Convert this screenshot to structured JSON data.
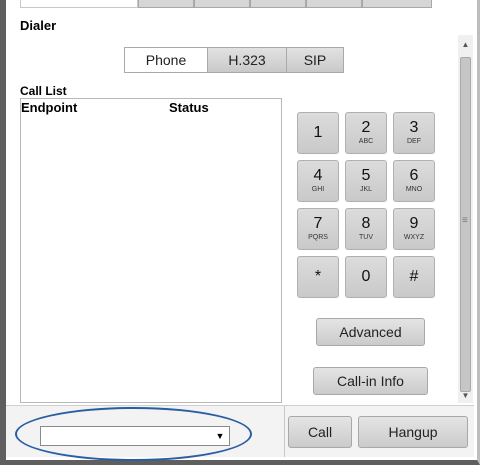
{
  "dialer": {
    "title": "Dialer"
  },
  "protocol_tabs": [
    {
      "label": "Phone",
      "active": true
    },
    {
      "label": "H.323",
      "active": false
    },
    {
      "label": "SIP",
      "active": false
    }
  ],
  "call_list": {
    "title": "Call List",
    "columns": [
      "Endpoint",
      "Status"
    ],
    "rows": []
  },
  "keypad": [
    {
      "digit": "1",
      "letters": ""
    },
    {
      "digit": "2",
      "letters": "ABC"
    },
    {
      "digit": "3",
      "letters": "DEF"
    },
    {
      "digit": "4",
      "letters": "GHI"
    },
    {
      "digit": "5",
      "letters": "JKL"
    },
    {
      "digit": "6",
      "letters": "MNO"
    },
    {
      "digit": "7",
      "letters": "PQRS"
    },
    {
      "digit": "8",
      "letters": "TUV"
    },
    {
      "digit": "9",
      "letters": "WXYZ"
    },
    {
      "digit": "*",
      "letters": ""
    },
    {
      "digit": "0",
      "letters": ""
    },
    {
      "digit": "#",
      "letters": ""
    }
  ],
  "buttons": {
    "advanced": "Advanced",
    "callin_info": "Call-in Info",
    "call": "Call",
    "hangup": "Hangup"
  },
  "number_input": {
    "value": ""
  },
  "colors": {
    "highlight_oval": "#2a5ea3",
    "frame": "#5f5f5f"
  }
}
